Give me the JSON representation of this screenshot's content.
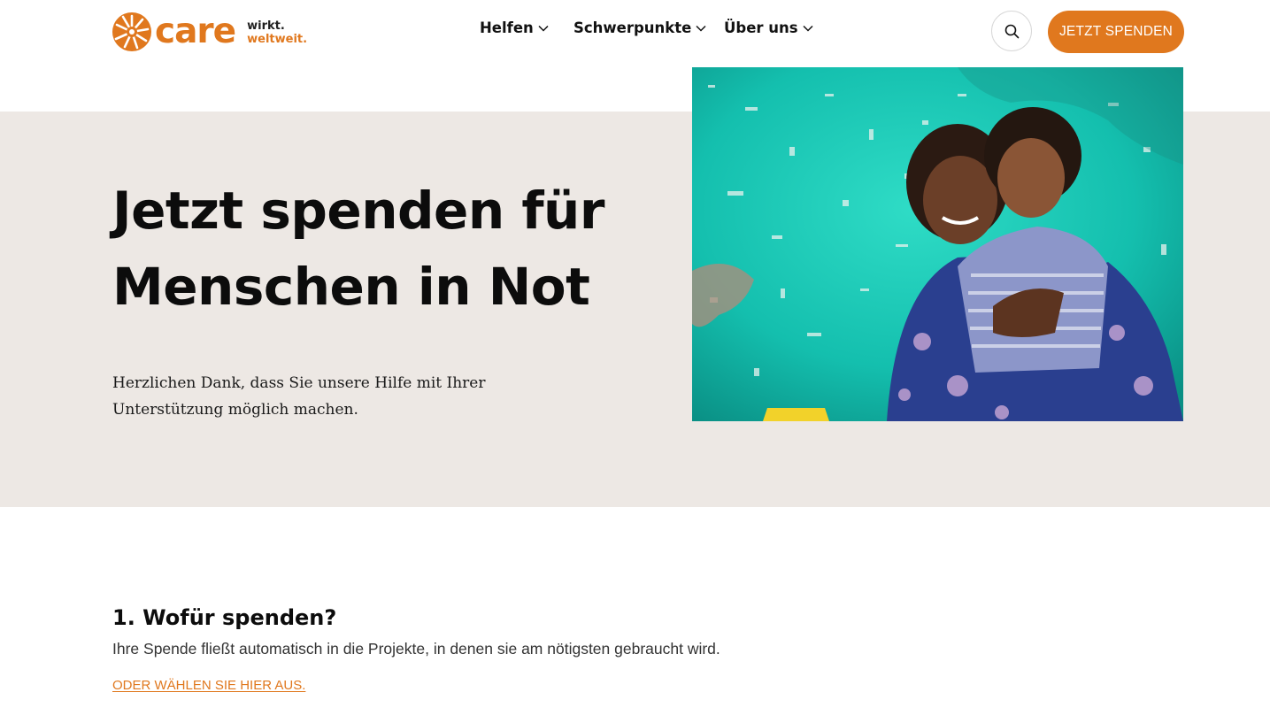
{
  "brand": {
    "logo_text": "care",
    "tagline_line1": "wirkt.",
    "tagline_line2": "weltweit.",
    "accent_color": "#e0781e"
  },
  "nav": {
    "items": [
      {
        "label": "Helfen",
        "icon": "chevron-down-icon"
      },
      {
        "label": "Schwerpunkte",
        "icon": "chevron-down-icon"
      },
      {
        "label": "Über uns",
        "icon": "chevron-down-icon"
      }
    ],
    "search_icon": "search-icon",
    "donate_label": "JETZT SPENDEN"
  },
  "hero": {
    "title_line1": "Jetzt spenden für",
    "title_line2": "Menschen in Not",
    "text_line1": "Herzlichen Dank, dass Sie unsere Hilfe mit Ihrer",
    "text_line2": "Unterstützung möglich machen.",
    "background_color": "#ede8e4",
    "image": "photo-mother-and-child"
  },
  "section": {
    "title": "1. Wofür spenden?",
    "text": "Ihre Spende fließt automatisch in die Projekte, in denen sie am nötigsten gebraucht wird.",
    "link": "ODER WÄHLEN SIE HIER AUS."
  }
}
